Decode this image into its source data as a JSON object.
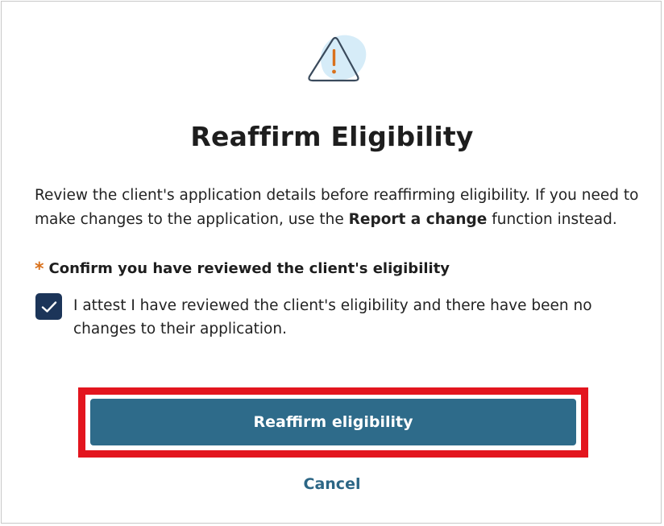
{
  "dialog": {
    "icon": "warning-triangle-icon",
    "title": "Reaffirm Eligibility",
    "description_before": "Review the client's application details before reaffirming eligibility. If you need to make changes to the application, use the ",
    "description_link": "Report a change",
    "description_after": " function instead.",
    "required_marker": "*",
    "confirm_label": "Confirm you have reviewed the client's eligibility",
    "checkbox_checked": true,
    "checkbox_text": "I attest I have reviewed the client's eligibility and there have been no changes to their application.",
    "primary_button_label": "Reaffirm eligibility",
    "cancel_label": "Cancel"
  },
  "colors": {
    "accent": "#2e6b8a",
    "checkbox": "#1c3559",
    "required": "#d9711c",
    "warning_icon": "#d9711c",
    "icon_blob": "#d6ecf8",
    "highlight": "#e3151e"
  }
}
